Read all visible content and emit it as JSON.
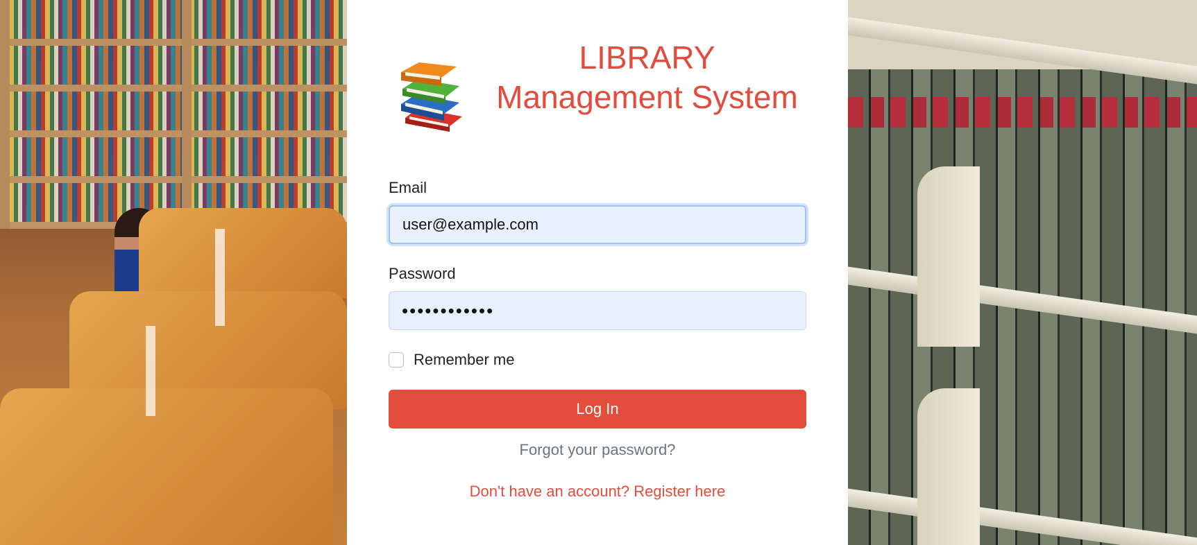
{
  "brand": {
    "title_line1": "LIBRARY",
    "title_line2": "Management System",
    "logo_icon": "stacked-books-icon",
    "accent_color": "#e44c3c"
  },
  "form": {
    "email_label": "Email",
    "email_value": "user@example.com",
    "password_label": "Password",
    "password_value": "••••••••••••",
    "remember_label": "Remember me",
    "remember_checked": false,
    "login_label": "Log In",
    "forgot_label": "Forgot your password?",
    "register_label": "Don't have an account? Register here"
  },
  "backgrounds": {
    "left": "library-reading-room-photo",
    "right": "library-bookshelves-photo"
  }
}
